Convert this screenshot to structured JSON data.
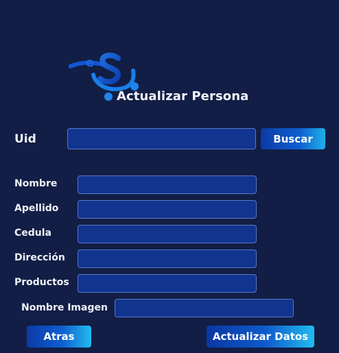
{
  "header": {
    "logo_icon": "es-brand-logo",
    "title": "Actualizar Persona"
  },
  "search": {
    "uid_label": "Uid",
    "uid_value": "",
    "search_button": "Buscar"
  },
  "form": {
    "fields": [
      {
        "label": "Nombre",
        "value": ""
      },
      {
        "label": "Apellido",
        "value": ""
      },
      {
        "label": "Cedula",
        "value": ""
      },
      {
        "label": "Dirección",
        "value": ""
      },
      {
        "label": "Productos",
        "value": ""
      },
      {
        "label": "Nombre Imagen",
        "value": ""
      }
    ]
  },
  "actions": {
    "back_button": "Atras",
    "update_button": "Actualizar Datos"
  },
  "colors": {
    "background": "#121e45",
    "field_fill": "#11348f",
    "field_border": "#5b77c9",
    "accent_light": "#21bdf0",
    "accent_dark": "#0c3aa6"
  }
}
